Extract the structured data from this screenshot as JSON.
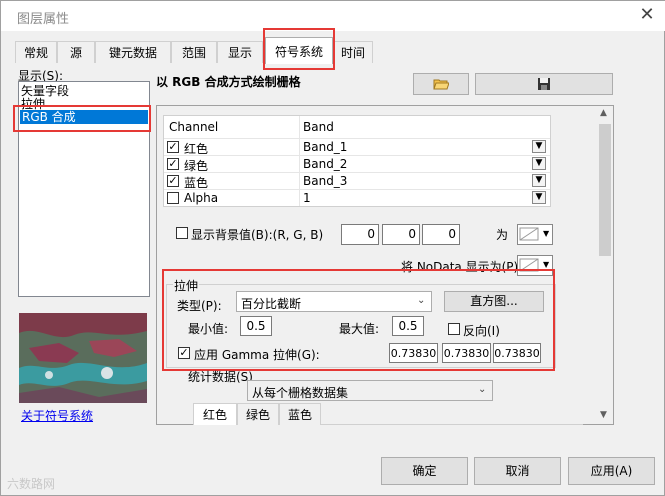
{
  "window": {
    "title": "图层属性",
    "close_glyph": "✕"
  },
  "tabs": [
    {
      "label": "常规"
    },
    {
      "label": "源"
    },
    {
      "label": "键元数据"
    },
    {
      "label": "范围"
    },
    {
      "label": "显示"
    },
    {
      "label": "符号系统",
      "active": true
    },
    {
      "label": "时间"
    }
  ],
  "show_panel": {
    "label": "显示(S):",
    "items": [
      {
        "label": "矢量字段"
      },
      {
        "label": "拉伸"
      },
      {
        "label": "RGB 合成",
        "selected": true
      }
    ],
    "about_link": "关于符号系统"
  },
  "main": {
    "heading": "以 RGB 合成方式绘制栅格",
    "open_icon": "folder-open-icon",
    "save_icon": "save-icon",
    "table": {
      "headers": [
        "Channel",
        "Band"
      ],
      "rows": [
        {
          "checked": true,
          "channel": "红色",
          "band": "Band_1"
        },
        {
          "checked": true,
          "channel": "绿色",
          "band": "Band_2"
        },
        {
          "checked": true,
          "channel": "蓝色",
          "band": "Band_3"
        },
        {
          "checked": false,
          "channel": "Alpha",
          "band": "1"
        }
      ]
    },
    "background": {
      "label": "显示背景值(B):(R, G, B)",
      "values": [
        "0",
        "0",
        "0"
      ],
      "as_label": "为"
    },
    "nodata_label": "将 NoData 显示为(P)",
    "stretch": {
      "title": "拉伸",
      "type_label": "类型(P):",
      "type_value": "百分比截断",
      "histogram_button": "直方图...",
      "min_label": "最小值:",
      "min_value": "0.5",
      "max_label": "最大值:",
      "max_value": "0.5",
      "invert_label": "反向(I)",
      "gamma_label": "应用 Gamma 拉伸(G):",
      "gamma_values": [
        "0.73830",
        "0.73830",
        "0.73830"
      ]
    },
    "stats": {
      "label": "统计数据(S)",
      "value": "从每个栅格数据集",
      "subtabs": [
        "红色",
        "绿色",
        "蓝色"
      ]
    }
  },
  "buttons": {
    "ok": "确定",
    "cancel": "取消",
    "apply": "应用(A)"
  },
  "watermark": "六数路网",
  "colors": {
    "selection": "#0078d7",
    "highlight_box": "#e53935",
    "link": "#0000ee"
  }
}
